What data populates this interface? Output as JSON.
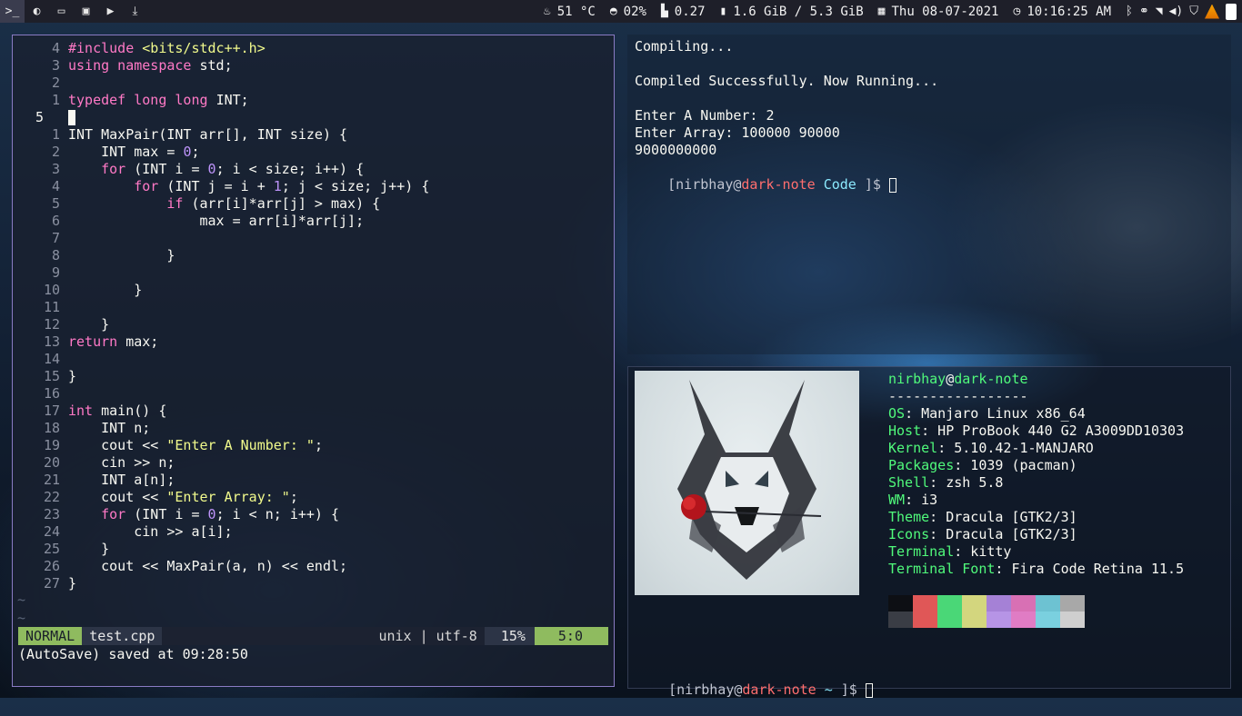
{
  "topbar": {
    "left_icons": [
      "terminal-icon",
      "browser-icon",
      "folder-icon",
      "files-icon",
      "media-player-icon",
      "download-icon"
    ],
    "temperature": "51 °C",
    "cpu": "02%",
    "load": "0.27",
    "memory": "1.6 GiB / 5.3 GiB",
    "date": "Thu 08-07-2021",
    "time": "10:16:25 AM",
    "tray_icons": [
      "bluetooth-icon",
      "link-icon",
      "wifi-icon",
      "volume-icon",
      "shield-icon",
      "vlc-icon",
      "battery-icon"
    ]
  },
  "vim": {
    "lines": [
      {
        "num": "4",
        "segs": [
          [
            "pp",
            "#include "
          ],
          [
            "inc",
            "<bits/stdc++.h>"
          ]
        ]
      },
      {
        "num": "3",
        "segs": [
          [
            "kw",
            "using namespace"
          ],
          [
            "",
            "std;"
          ]
        ]
      },
      {
        "num": "2",
        "segs": []
      },
      {
        "num": "1",
        "segs": [
          [
            "kw",
            "typedef long long"
          ],
          [
            "",
            "INT;"
          ]
        ]
      },
      {
        "num": "5",
        "current": true,
        "segs": []
      },
      {
        "num": "1",
        "segs": [
          [
            "",
            "INT MaxPair(INT arr[], INT size) {"
          ]
        ]
      },
      {
        "num": "2",
        "segs": [
          [
            "",
            "    INT max = "
          ],
          [
            "num",
            "0"
          ],
          [
            "",
            ";"
          ]
        ]
      },
      {
        "num": "3",
        "segs": [
          [
            "",
            "    "
          ],
          [
            "kw",
            "for"
          ],
          [
            "",
            "(INT i = "
          ],
          [
            "num",
            "0"
          ],
          [
            "",
            "; i < size; i++) {"
          ]
        ]
      },
      {
        "num": "4",
        "segs": [
          [
            "",
            "        "
          ],
          [
            "kw",
            "for"
          ],
          [
            "",
            "(INT j = i + "
          ],
          [
            "num",
            "1"
          ],
          [
            "",
            "; j < size; j++) {"
          ]
        ]
      },
      {
        "num": "5",
        "segs": [
          [
            "",
            "            "
          ],
          [
            "kw",
            "if"
          ],
          [
            "",
            "(arr[i]*arr[j] > max) {"
          ]
        ]
      },
      {
        "num": "6",
        "segs": [
          [
            "",
            "                max = arr[i]*arr[j];"
          ]
        ]
      },
      {
        "num": "7",
        "segs": []
      },
      {
        "num": "8",
        "segs": [
          [
            "",
            "            }"
          ]
        ]
      },
      {
        "num": "9",
        "segs": []
      },
      {
        "num": "10",
        "segs": [
          [
            "",
            "        }"
          ]
        ]
      },
      {
        "num": "11",
        "segs": []
      },
      {
        "num": "12",
        "segs": [
          [
            "",
            "    }"
          ]
        ]
      },
      {
        "num": "13",
        "segs": [
          [
            "kw",
            "return"
          ],
          [
            "",
            " max;"
          ]
        ]
      },
      {
        "num": "14",
        "segs": []
      },
      {
        "num": "15",
        "segs": [
          [
            "",
            "}"
          ]
        ]
      },
      {
        "num": "16",
        "segs": []
      },
      {
        "num": "17",
        "segs": [
          [
            "kw",
            "int"
          ],
          [
            "",
            " main() {"
          ]
        ]
      },
      {
        "num": "18",
        "segs": [
          [
            "",
            "    INT n;"
          ]
        ]
      },
      {
        "num": "19",
        "segs": [
          [
            "",
            "    cout << "
          ],
          [
            "str",
            "\"Enter A Number: \""
          ],
          [
            "",
            ";"
          ]
        ]
      },
      {
        "num": "20",
        "segs": [
          [
            "",
            "    cin >> n;"
          ]
        ]
      },
      {
        "num": "21",
        "segs": [
          [
            "",
            "    INT a[n];"
          ]
        ]
      },
      {
        "num": "22",
        "segs": [
          [
            "",
            "    cout << "
          ],
          [
            "str",
            "\"Enter Array: \""
          ],
          [
            "",
            ";"
          ]
        ]
      },
      {
        "num": "23",
        "segs": [
          [
            "",
            "    "
          ],
          [
            "kw",
            "for"
          ],
          [
            "",
            "(INT i = "
          ],
          [
            "num",
            "0"
          ],
          [
            "",
            "; i < n; i++) {"
          ]
        ]
      },
      {
        "num": "24",
        "segs": [
          [
            "",
            "        cin >> a[i];"
          ]
        ]
      },
      {
        "num": "25",
        "segs": [
          [
            "",
            "    }"
          ]
        ]
      },
      {
        "num": "26",
        "segs": [
          [
            "",
            "    cout << MaxPair(a, n) << endl;"
          ]
        ]
      },
      {
        "num": "27",
        "segs": [
          [
            "",
            "}"
          ]
        ]
      }
    ],
    "tilde": "~",
    "status": {
      "mode": "NORMAL",
      "file": "test.cpp",
      "encoding": "unix | utf-8",
      "percent": "15%",
      "position": "5:0"
    },
    "cmdline": "(AutoSave) saved at 09:28:50"
  },
  "term1": {
    "lines": [
      "Compiling...",
      "",
      "Compiled Successfully. Now Running...",
      "",
      "Enter A Number: 2",
      "Enter Array: 100000 90000",
      "9000000000"
    ],
    "prompt": {
      "open": "[",
      "user": "nirbhay",
      "at": "@",
      "host": "dark-note",
      "dir": "Code",
      "close": " ]$"
    }
  },
  "term2": {
    "title_user": "nirbhay",
    "title_at": "@",
    "title_host": "dark-note",
    "separator": "-----------------",
    "info": [
      {
        "label": "OS",
        "value": ": Manjaro Linux x86_64"
      },
      {
        "label": "Host",
        "value": ": HP ProBook 440 G2 A3009DD10303"
      },
      {
        "label": "Kernel",
        "value": ": 5.10.42-1-MANJARO"
      },
      {
        "label": "Packages",
        "value": ": 1039 (pacman)"
      },
      {
        "label": "Shell",
        "value": ": zsh 5.8"
      },
      {
        "label": "WM",
        "value": ": i3"
      },
      {
        "label": "Theme",
        "value": ": Dracula [GTK2/3]"
      },
      {
        "label": "Icons",
        "value": ": Dracula [GTK2/3]"
      },
      {
        "label": "Terminal",
        "value": ": kitty"
      },
      {
        "label": "Terminal Font",
        "value": ": Fira Code Retina 11.5"
      }
    ],
    "palette_top": [
      "#0d0f14",
      "#e05757",
      "#4ad777",
      "#d3d67e",
      "#a581d6",
      "#d870b4",
      "#6dc2d2",
      "#a8a8a8"
    ],
    "palette_bottom": [
      "#3a3d45",
      "#e05757",
      "#4ad777",
      "#d3d67e",
      "#b694e6",
      "#e07cc4",
      "#7ad0df",
      "#cfcfcf"
    ],
    "prompt": {
      "open": "[",
      "user": "nirbhay",
      "at": "@",
      "host": "dark-note",
      "dir": "~",
      "close": " ]$"
    }
  }
}
